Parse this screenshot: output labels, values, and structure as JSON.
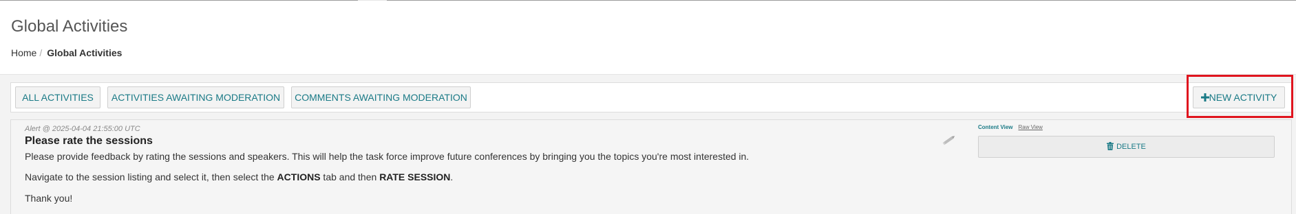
{
  "header": {
    "title": "Global Activities",
    "breadcrumb": {
      "home": "Home",
      "separator": "/",
      "current": "Global Activities"
    }
  },
  "toolbar": {
    "all_activities": "ALL ACTIVITIES",
    "activities_awaiting_moderation": "ACTIVITIES AWAITING MODERATION",
    "comments_awaiting_moderation": "COMMENTS AWAITING MODERATION",
    "new_activity_icon": "plus-icon",
    "new_activity": "NEW ACTIVITY"
  },
  "activity": {
    "meta": "Alert @ 2025-04-04 21:55:00 UTC",
    "title": "Please rate the sessions",
    "body_1": "Please provide feedback by rating the sessions and speakers.  This will help the task force improve future conferences by bringing you the topics you're most interested in.",
    "body_2_pre": "Navigate to the session listing and select it, then select the ",
    "body_2_actions": "ACTIONS",
    "body_2_mid": " tab and then ",
    "body_2_rate": "RATE SESSION",
    "body_2_post": ".",
    "body_3": "Thank you!",
    "edit_icon": "pencil-icon",
    "content_view": "Content View",
    "raw_view": "Raw View",
    "delete_icon": "trash-icon",
    "delete": "DELETE"
  },
  "colors": {
    "accent": "#1a7a86",
    "highlight": "#e0141e",
    "background": "#f3f3f3"
  }
}
